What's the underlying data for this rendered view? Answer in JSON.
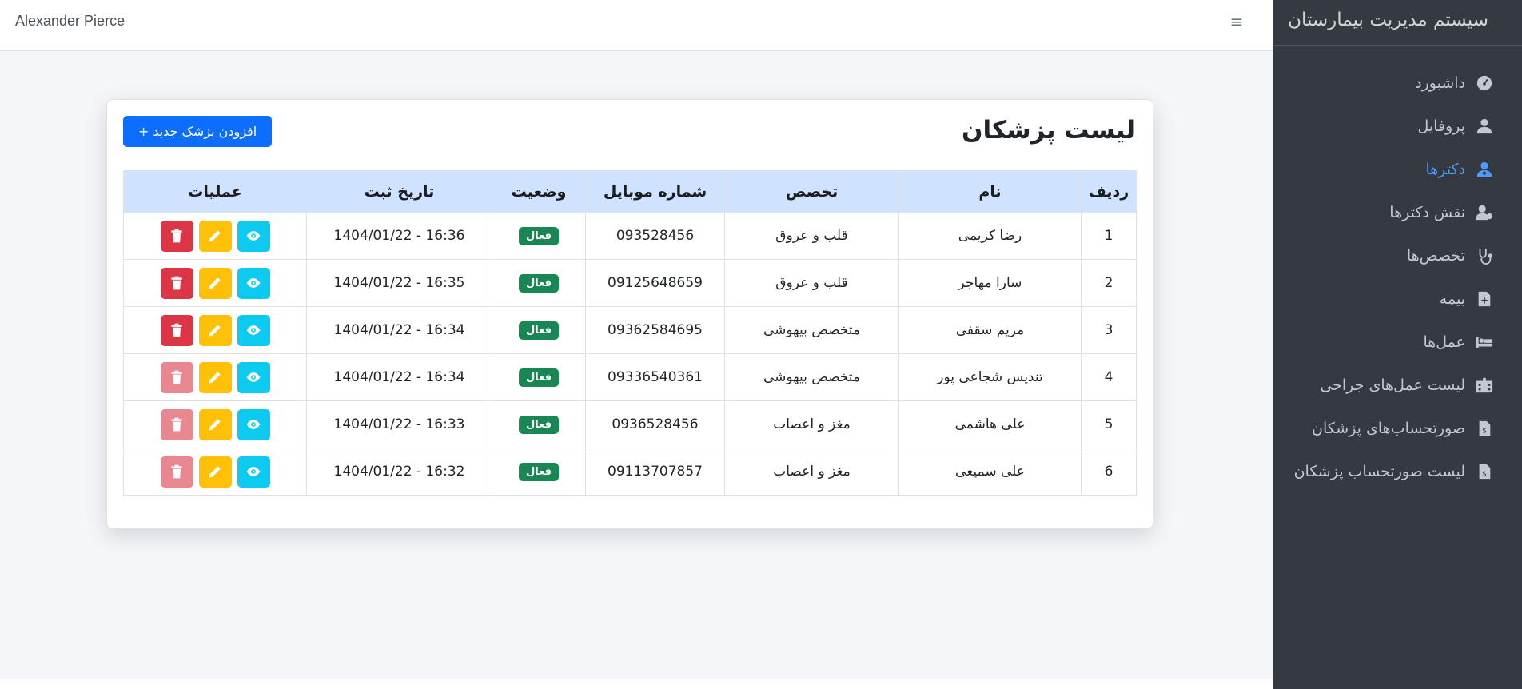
{
  "navbar": {
    "user_name": "Alexander Pierce",
    "toggle_icon": "bars-icon"
  },
  "sidebar": {
    "brand": "سیستم مدیریت بیمارستان",
    "items": [
      {
        "label": "داشبورد",
        "icon": "gauge-icon",
        "active": false
      },
      {
        "label": "پروفایل",
        "icon": "user-icon",
        "active": false
      },
      {
        "label": "دکترها",
        "icon": "user-doctor-icon",
        "active": true
      },
      {
        "label": "نقش دکترها",
        "icon": "user-gear-icon",
        "active": false
      },
      {
        "label": "تخصص‌ها",
        "icon": "stethoscope-icon",
        "active": false
      },
      {
        "label": "بیمه",
        "icon": "file-medical-icon",
        "active": false
      },
      {
        "label": "عمل‌ها",
        "icon": "bed-icon",
        "active": false
      },
      {
        "label": "لیست عمل‌های جراحی",
        "icon": "hospital-icon",
        "active": false
      },
      {
        "label": "صورتحساب‌های پزشکان",
        "icon": "invoice-icon",
        "active": false
      },
      {
        "label": "لیست صورتحساب پزشکان",
        "icon": "invoice-dollar-icon",
        "active": false
      }
    ]
  },
  "card": {
    "title": "لیست پزشکان",
    "add_button": "افزودن پزشک جدید +"
  },
  "table": {
    "headers": [
      "ردیف",
      "نام",
      "تخصص",
      "شماره موبایل",
      "وضعیت",
      "تاریخ ثبت",
      "عملیات"
    ],
    "rows": [
      {
        "num": "1",
        "name": "رضا کریمی",
        "specialty": "قلب و عروق",
        "mobile": "093528456",
        "status": "فعال",
        "date": "1404/01/22 - 16:36"
      },
      {
        "num": "2",
        "name": "سارا مهاجر",
        "specialty": "قلب و عروق",
        "mobile": "09125648659",
        "status": "فعال",
        "date": "1404/01/22 - 16:35"
      },
      {
        "num": "3",
        "name": "مریم سقفی",
        "specialty": "متخصص بیهوشی",
        "mobile": "09362584695",
        "status": "فعال",
        "date": "1404/01/22 - 16:34"
      },
      {
        "num": "4",
        "name": "تندیس شجاعی پور",
        "specialty": "متخصص بیهوشی",
        "mobile": "09336540361",
        "status": "فعال",
        "date": "1404/01/22 - 16:34"
      },
      {
        "num": "5",
        "name": "علی هاشمی",
        "specialty": "مغز و اعصاب",
        "mobile": "0936528456",
        "status": "فعال",
        "date": "1404/01/22 - 16:33"
      },
      {
        "num": "6",
        "name": "علی سمیعی",
        "specialty": "مغز و اعصاب",
        "mobile": "09113707857",
        "status": "فعال",
        "date": "1404/01/22 - 16:32"
      }
    ]
  },
  "colors": {
    "sidebar_bg": "#343a40",
    "primary": "#0d6efd",
    "active_link": "#4d9cff",
    "header_bg": "#cfe2ff",
    "badge": "#198754",
    "view": "#0dcaf0",
    "edit": "#ffc107",
    "delete": "#dc3545",
    "delete_disabled": "#e88790"
  }
}
